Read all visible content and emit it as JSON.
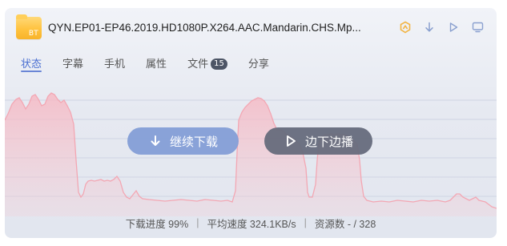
{
  "header": {
    "file_badge": "BT",
    "title": "QYN.EP01-EP46.2019.HD1080P.X264.AAC.Mandarin.CHS.Mp...",
    "icons": [
      "speedup-icon",
      "download-icon",
      "play-icon",
      "screen-icon"
    ]
  },
  "tabs": [
    {
      "label": "状态"
    },
    {
      "label": "字幕"
    },
    {
      "label": "手机"
    },
    {
      "label": "属性"
    },
    {
      "label": "文件",
      "badge": "15"
    },
    {
      "label": "分享"
    }
  ],
  "buttons": {
    "download_label": "继续下载",
    "play_label": "边下边播"
  },
  "footer": {
    "progress": "下载进度 99%",
    "speed": "平均速度 324.1KB/s",
    "sources": "资源数 - / 328"
  },
  "colors": {
    "accent": "#4a6fd1",
    "chart_line": "#f3a7b3",
    "chart_fill": "#f7c3cc",
    "download_button": "#849ed6",
    "play_button": "#666c7c"
  }
}
